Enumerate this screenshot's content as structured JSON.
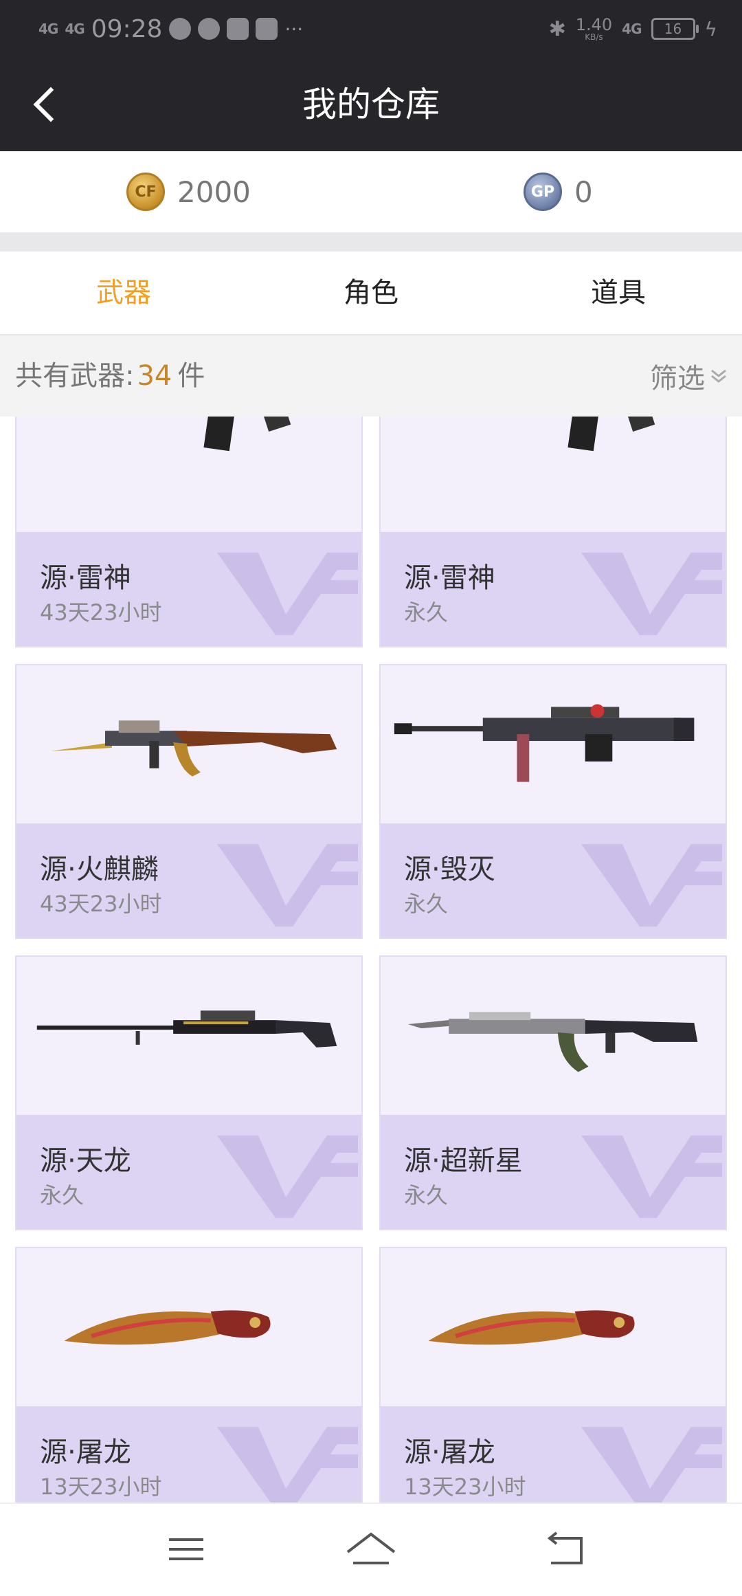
{
  "status_bar": {
    "signal1": "4G",
    "signal2": "4G",
    "time": "09:28",
    "more": "···",
    "net_speed": "1.40",
    "net_unit": "KB/s",
    "network": "4G",
    "battery": "16"
  },
  "header": {
    "title": "我的仓库"
  },
  "currency": {
    "cf_points": "2000",
    "gp": "0",
    "cf_icon": "cf-coin-icon",
    "gp_icon": "gp-coin-icon",
    "gp_label": "GP"
  },
  "tabs": [
    {
      "label": "武器",
      "active": true
    },
    {
      "label": "角色",
      "active": false
    },
    {
      "label": "道具",
      "active": false
    }
  ],
  "summary": {
    "prefix": "共有武器:",
    "count": "34",
    "unit": "件",
    "filter_label": "筛选"
  },
  "items": [
    {
      "name": "源·雷神",
      "duration": "43天23小时",
      "weapon": "rifle"
    },
    {
      "name": "源·雷神",
      "duration": "永久",
      "weapon": "rifle"
    },
    {
      "name": "源·火麒麟",
      "duration": "43天23小时",
      "weapon": "ak"
    },
    {
      "name": "源·毁灭",
      "duration": "永久",
      "weapon": "barrett"
    },
    {
      "name": "源·天龙",
      "duration": "永久",
      "weapon": "sniper"
    },
    {
      "name": "源·超新星",
      "duration": "永久",
      "weapon": "assault"
    },
    {
      "name": "源·屠龙",
      "duration": "13天23小时",
      "weapon": "knife"
    },
    {
      "name": "源·屠龙",
      "duration": "13天23小时",
      "weapon": "knife"
    }
  ],
  "colors": {
    "accent": "#f2a024",
    "header_bg": "#26252a",
    "card_info_bg": "#ddd3f3",
    "count": "#c8862a"
  }
}
